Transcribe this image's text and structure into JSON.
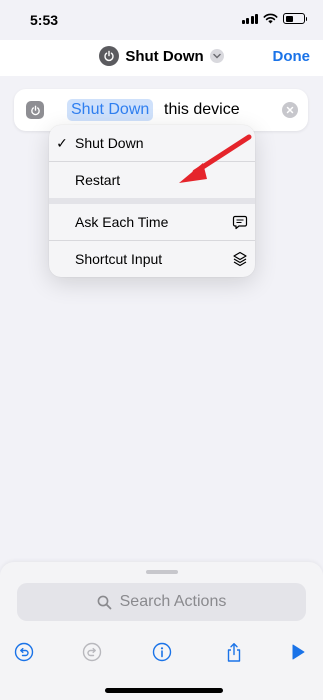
{
  "status_bar": {
    "time": "5:53",
    "icons": [
      "cellular-signal-icon",
      "wifi-icon",
      "battery-icon"
    ]
  },
  "nav": {
    "title": "Shut Down",
    "done_label": "Done",
    "app_icon": "power-icon",
    "menu_icon": "chevron-down-icon"
  },
  "action": {
    "icon": "power-icon",
    "parameter": "Shut Down",
    "text": "this device",
    "clear_icon": "clear-icon"
  },
  "menu": {
    "items": [
      {
        "label": "Shut Down",
        "checked": true
      },
      {
        "label": "Restart",
        "checked": false
      },
      {
        "label": "Ask Each Time",
        "icon": "speech-bubble-icon"
      },
      {
        "label": "Shortcut Input",
        "icon": "shortcut-layers-icon"
      }
    ]
  },
  "annotation": {
    "icon": "red-arrow",
    "points_to": "Restart"
  },
  "search": {
    "placeholder": "Search Actions",
    "icon": "search-icon"
  },
  "toolbar": {
    "items": [
      "undo-icon",
      "redo-icon",
      "info-icon",
      "share-icon",
      "play-icon"
    ]
  },
  "colors": {
    "accent": "#1a73e8",
    "parameter_bg": "#cfe1fb",
    "parameter_text": "#2f7ff0",
    "annotation_red": "#e5242b",
    "background": "#f2f2f7"
  }
}
